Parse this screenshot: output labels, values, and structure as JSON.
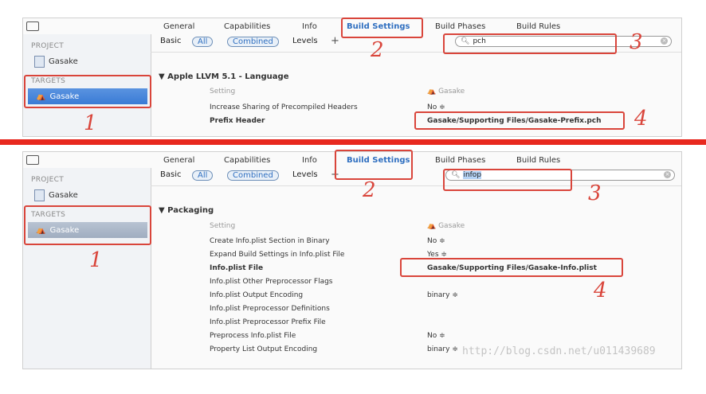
{
  "tabs": [
    "General",
    "Capabilities",
    "Info",
    "Build Settings",
    "Build Phases",
    "Build Rules"
  ],
  "filters": {
    "basic": "Basic",
    "all": "All",
    "combined": "Combined",
    "levels": "Levels",
    "plus": "+"
  },
  "sidebar": {
    "project_header": "PROJECT",
    "project_name": "Gasake",
    "targets_header": "TARGETS",
    "target_name": "Gasake"
  },
  "colors": {
    "active_tab": "#2f6fc0",
    "selection_top": "#3a7bd5",
    "selection_bottom": "#a9b6c8",
    "annotation": "#d9453b"
  },
  "top": {
    "search_value": "pch",
    "group": "Apple LLVM 5.1 - Language",
    "setting_header": "Setting",
    "value_header": "Gasake",
    "rows": [
      {
        "name": "Increase Sharing of Precompiled Headers",
        "value": "No ≑",
        "bold": false
      },
      {
        "name": "Prefix Header",
        "value": "Gasake/Supporting Files/Gasake-Prefix.pch",
        "bold": true
      }
    ],
    "annotations": [
      "1",
      "2",
      "3",
      "4"
    ]
  },
  "bottom": {
    "search_value": "infop",
    "group": "Packaging",
    "setting_header": "Setting",
    "value_header": "Gasake",
    "rows": [
      {
        "name": "Create Info.plist Section in Binary",
        "value": "No ≑",
        "bold": false
      },
      {
        "name": "Expand Build Settings in Info.plist File",
        "value": "Yes ≑",
        "bold": false
      },
      {
        "name": "Info.plist File",
        "value": "Gasake/Supporting Files/Gasake-Info.plist",
        "bold": true
      },
      {
        "name": "Info.plist Other Preprocessor Flags",
        "value": "",
        "bold": false
      },
      {
        "name": "Info.plist Output Encoding",
        "value": "binary ≑",
        "bold": false
      },
      {
        "name": "Info.plist Preprocessor Definitions",
        "value": "",
        "bold": false
      },
      {
        "name": "Info.plist Preprocessor Prefix File",
        "value": "",
        "bold": false
      },
      {
        "name": "Preprocess Info.plist File",
        "value": "No ≑",
        "bold": false
      },
      {
        "name": "Property List Output Encoding",
        "value": "binary ≑",
        "bold": false
      }
    ],
    "annotations": [
      "1",
      "2",
      "3",
      "4"
    ]
  },
  "watermark": "http://blog.csdn.net/u011439689"
}
